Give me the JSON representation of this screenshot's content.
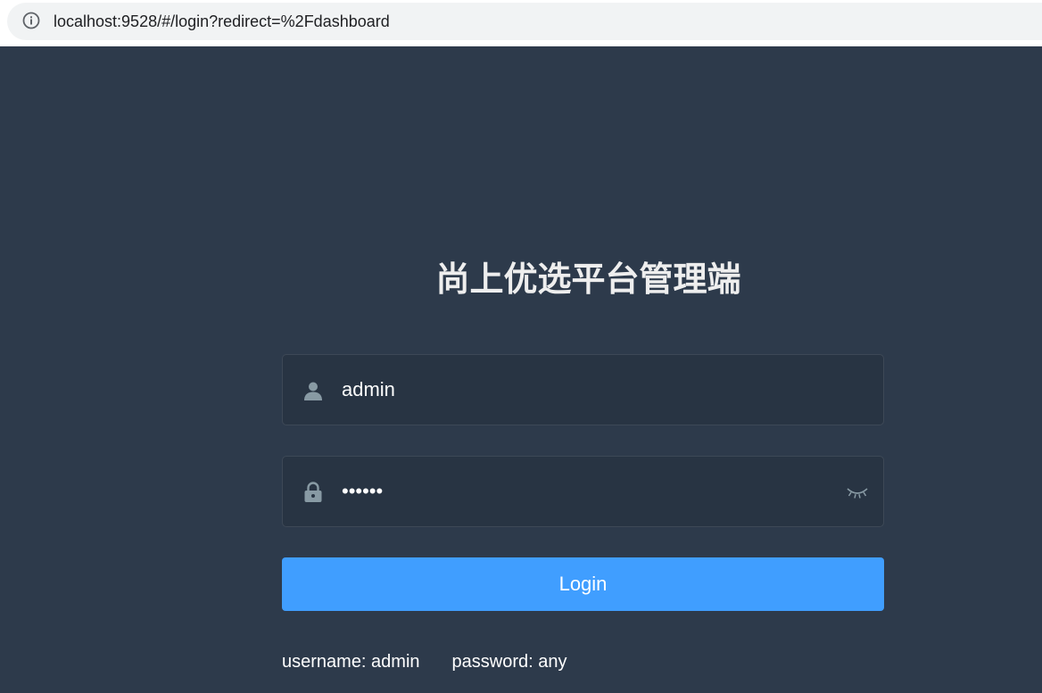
{
  "browser": {
    "url": "localhost:9528/#/login?redirect=%2Fdashboard",
    "info_icon": "info-circle-icon"
  },
  "login": {
    "title": "尚上优选平台管理端",
    "username": {
      "value": "admin",
      "placeholder": "",
      "icon": "user-icon"
    },
    "password": {
      "masked_value": "••••••",
      "icon": "lock-icon",
      "toggle_icon": "eye-closed-icon"
    },
    "login_label": "Login",
    "tips": {
      "username": "username: admin",
      "password": "password: any"
    }
  },
  "colors": {
    "background": "#2d3a4b",
    "input_background": "#283443",
    "button": "#409eff",
    "icon": "#889aa4"
  }
}
